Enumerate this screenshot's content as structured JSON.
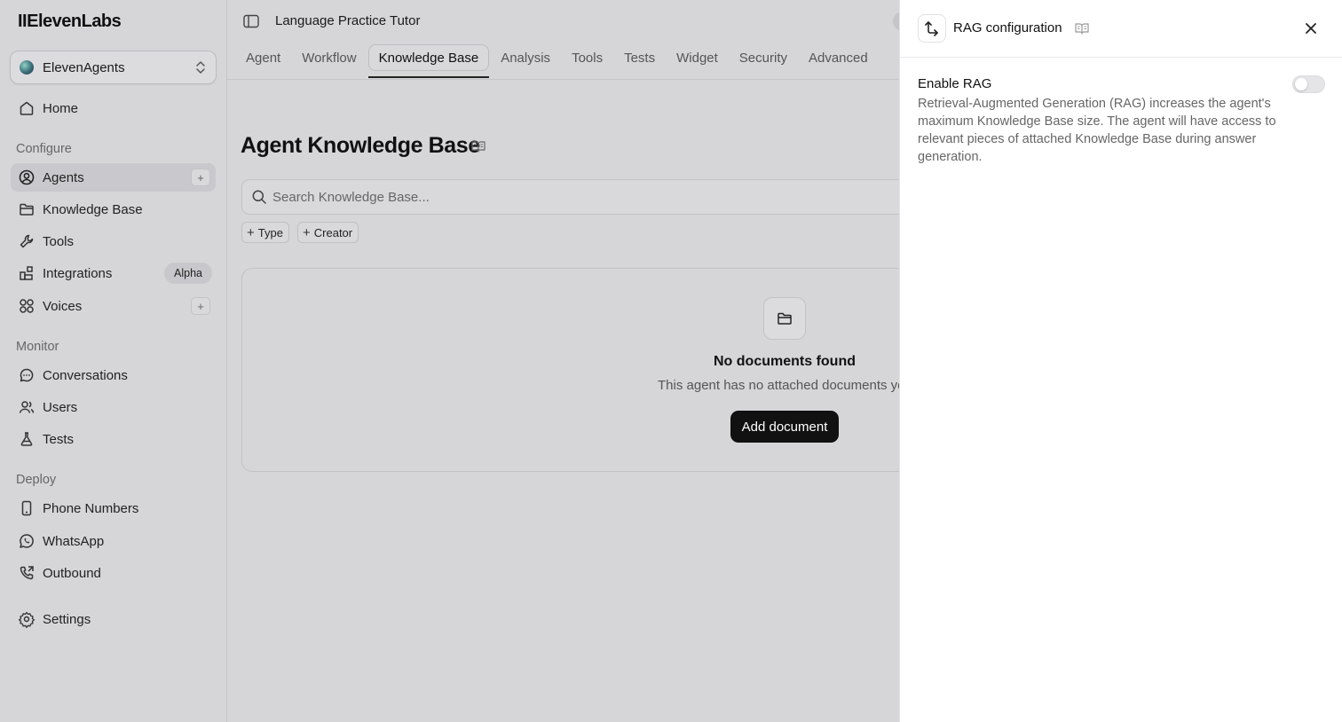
{
  "sidebar": {
    "logo": "IIElevenLabs",
    "workspace": "ElevenAgents",
    "items": {
      "home": "Home",
      "agents": "Agents",
      "knowledge_base": "Knowledge Base",
      "tools": "Tools",
      "integrations": "Integrations",
      "integrations_badge": "Alpha",
      "voices": "Voices",
      "conversations": "Conversations",
      "users": "Users",
      "tests": "Tests",
      "phone_numbers": "Phone Numbers",
      "whatsapp": "WhatsApp",
      "outbound": "Outbound",
      "settings": "Settings"
    },
    "sections": {
      "configure": "Configure",
      "monitor": "Monitor",
      "deploy": "Deploy"
    },
    "plus": "+"
  },
  "header": {
    "agent_name": "Language Practice Tutor"
  },
  "tabs": [
    "Agent",
    "Workflow",
    "Knowledge Base",
    "Analysis",
    "Tools",
    "Tests",
    "Widget",
    "Security",
    "Advanced"
  ],
  "active_tab": "Knowledge Base",
  "knowledge_base": {
    "title": "Agent Knowledge Base",
    "search_placeholder": "Search Knowledge Base...",
    "filters": {
      "type": "Type",
      "creator": "Creator"
    },
    "empty_title": "No documents found",
    "empty_subtitle": "This agent has no attached documents yet.",
    "add_button": "Add document"
  },
  "panel": {
    "title": "RAG configuration",
    "enable_label": "Enable RAG",
    "enable_description": "Retrieval-Augmented Generation (RAG) increases the agent's maximum Knowledge Base size. The agent will have access to relevant pieces of attached Knowledge Base during answer generation.",
    "enabled": false
  },
  "icons": {
    "home": "home-icon",
    "agents": "user-circle-icon",
    "knowledge_base": "folder-icon",
    "tools": "wrench-icon",
    "integrations": "blocks-icon",
    "voices": "grid-circles-icon",
    "conversations": "chat-icon",
    "users": "users-icon",
    "tests": "flask-icon",
    "phone_numbers": "phone-icon",
    "whatsapp": "whatsapp-icon",
    "outbound": "phone-outgoing-icon",
    "settings": "gear-icon"
  }
}
